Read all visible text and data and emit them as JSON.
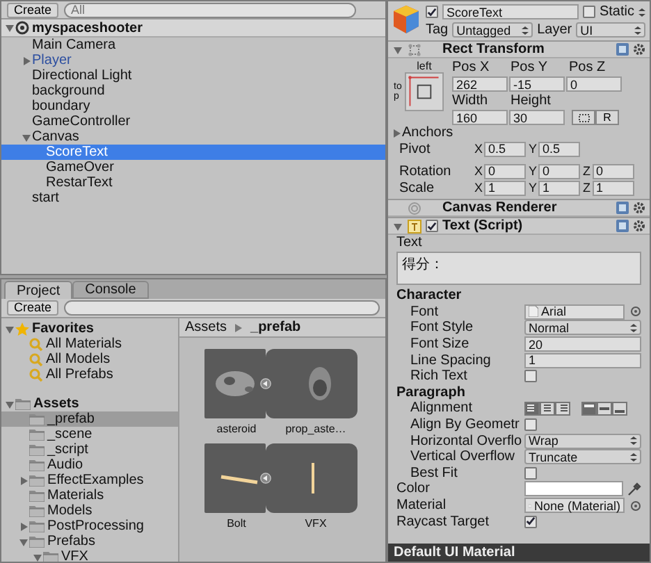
{
  "hierarchy": {
    "create": "Create",
    "search_placeholder": "All",
    "scene": {
      "name": "myspaceshooter",
      "expanded": true
    },
    "items": [
      {
        "name": "Main Camera",
        "selected": false,
        "prefab": false
      },
      {
        "name": "Player",
        "selected": false,
        "prefab": true,
        "expanded": false
      },
      {
        "name": "Directional Light",
        "selected": false,
        "prefab": false
      },
      {
        "name": "background",
        "selected": false,
        "prefab": false
      },
      {
        "name": "boundary",
        "selected": false,
        "prefab": false
      },
      {
        "name": "GameController",
        "selected": false,
        "prefab": false
      },
      {
        "name": "Canvas",
        "selected": false,
        "prefab": false,
        "expanded": true,
        "children": [
          {
            "name": "ScoreText",
            "selected": true,
            "prefab": false
          },
          {
            "name": "GameOver",
            "selected": false,
            "prefab": false
          },
          {
            "name": "RestarText",
            "selected": false,
            "prefab": false
          }
        ]
      },
      {
        "name": "start",
        "selected": false,
        "prefab": false
      }
    ]
  },
  "project": {
    "tabs": [
      {
        "label": "Project",
        "selected": true
      },
      {
        "label": "Console",
        "selected": false
      }
    ],
    "create": "Create",
    "favorites": {
      "label": "Favorites",
      "expanded": true,
      "items": [
        "All Materials",
        "All Models",
        "All Prefabs"
      ]
    },
    "assets": {
      "label": "Assets",
      "expanded": true,
      "children": [
        {
          "name": "_prefab",
          "selected": true
        },
        {
          "name": "_scene",
          "selected": false
        },
        {
          "name": "_script",
          "selected": false
        },
        {
          "name": "Audio",
          "selected": false
        },
        {
          "name": "EffectExamples",
          "selected": false,
          "expanded": false
        },
        {
          "name": "Materials",
          "selected": false
        },
        {
          "name": "Models",
          "selected": false
        },
        {
          "name": "PostProcessing",
          "selected": false,
          "expanded": false
        },
        {
          "name": "Prefabs",
          "selected": false,
          "expanded": true,
          "children": [
            {
              "name": "VFX",
              "selected": false,
              "expanded": true
            }
          ]
        }
      ]
    },
    "breadcrumb": [
      "Assets",
      "_prefab"
    ],
    "prefabs": [
      {
        "labels": [
          "asteroid",
          "prop_aste…"
        ],
        "kind": "rock"
      },
      {
        "labels": [
          "Bolt",
          "VFX"
        ],
        "kind": "bolt"
      }
    ]
  },
  "inspector": {
    "active": true,
    "name": "ScoreText",
    "static": {
      "label": "Static",
      "checked": false
    },
    "tag": {
      "label": "Tag",
      "value": "Untagged"
    },
    "layer": {
      "label": "Layer",
      "value": "UI"
    },
    "rect_transform": {
      "title": "Rect Transform",
      "expanded": true,
      "anchor_h": "left",
      "anchor_v": "top",
      "rows": [
        [
          {
            "label": "Pos X",
            "value": "262"
          },
          {
            "label": "Pos Y",
            "value": "-15"
          },
          {
            "label": "Pos Z",
            "value": "0"
          }
        ],
        [
          {
            "label": "Width",
            "value": "160"
          },
          {
            "label": "Height",
            "value": "30"
          }
        ]
      ],
      "reset": "R",
      "anchors": {
        "label": "Anchors",
        "expanded": false
      },
      "vectors": [
        {
          "label": "Pivot",
          "values": [
            {
              "axis": "X",
              "value": "0.5"
            },
            {
              "axis": "Y",
              "value": "0.5"
            }
          ]
        },
        {
          "label": "Rotation",
          "values": [
            {
              "axis": "X",
              "value": "0"
            },
            {
              "axis": "Y",
              "value": "0"
            },
            {
              "axis": "Z",
              "value": "0"
            }
          ]
        },
        {
          "label": "Scale",
          "values": [
            {
              "axis": "X",
              "value": "1"
            },
            {
              "axis": "Y",
              "value": "1"
            },
            {
              "axis": "Z",
              "value": "1"
            }
          ]
        }
      ]
    },
    "canvas_renderer": {
      "title": "Canvas Renderer"
    },
    "text_script": {
      "title": "Text (Script)",
      "enabled": true,
      "expanded": true,
      "text_label": "Text",
      "text_value": "得分：",
      "sections": [
        {
          "title": "Character",
          "rows": [
            {
              "kind": "object",
              "label": "Font",
              "value": "Arial"
            },
            {
              "kind": "dropdown",
              "label": "Font Style",
              "value": "Normal"
            },
            {
              "kind": "number",
              "label": "Font Size",
              "value": "20"
            },
            {
              "kind": "number",
              "label": "Line Spacing",
              "value": "1"
            },
            {
              "kind": "checkbox",
              "label": "Rich Text",
              "checked": false
            }
          ]
        },
        {
          "title": "Paragraph",
          "rows": [
            {
              "kind": "alignment",
              "label": "Alignment",
              "horizontal": [
                {
                  "selected": true
                },
                {
                  "selected": false
                },
                {
                  "selected": false
                }
              ],
              "vertical": [
                {
                  "selected": true
                },
                {
                  "selected": false
                },
                {
                  "selected": false
                }
              ]
            },
            {
              "kind": "checkbox",
              "label": "Align By Geometr",
              "checked": false
            },
            {
              "kind": "dropdown",
              "label": "Horizontal Overflo",
              "value": "Wrap"
            },
            {
              "kind": "dropdown",
              "label": "Vertical Overflow",
              "value": "Truncate"
            },
            {
              "kind": "checkbox",
              "label": "Best Fit",
              "checked": false
            }
          ]
        }
      ],
      "fields": [
        {
          "kind": "color",
          "label": "Color",
          "color": "#ffffff"
        },
        {
          "kind": "object",
          "label": "Material",
          "value": "None (Material)"
        },
        {
          "kind": "checkbox",
          "label": "Raycast Target",
          "checked": true
        }
      ]
    },
    "footer": "Default UI Material"
  }
}
